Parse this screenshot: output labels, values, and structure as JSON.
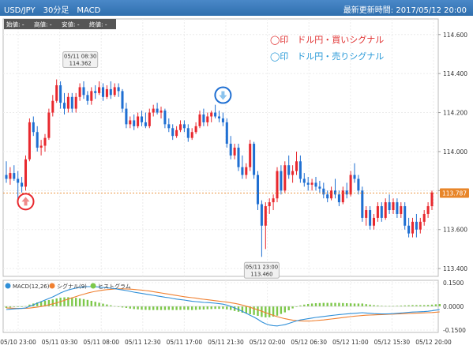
{
  "header": {
    "title": "USD/JPY　30分足　MACD",
    "updated": "最新更新時間: 2017/05/12 20:00"
  },
  "ohlc_box": {
    "labels": [
      "始値: -",
      "高値: -",
      "安値: -",
      "終値: -"
    ]
  },
  "legend": {
    "buy": "◯印　ドル円・買いシグナル",
    "sell": "◯印　ドル円・売りシグナル",
    "buy_color": "#e03030",
    "sell_color": "#2a9ad8"
  },
  "colors": {
    "up": "#e8282e",
    "down": "#1f6fd2",
    "macd": "#2f8fd8",
    "signal": "#f08030",
    "hist": "#7dc84a",
    "last_price_bg": "#e8862a"
  },
  "icons": {
    "buy_marker": "up-arrow-icon",
    "sell_marker": "down-arrow-icon"
  },
  "chart_data": [
    {
      "type": "candlestick",
      "title": "USD/JPY 30分足",
      "y_ticks": [
        "114.600",
        "114.400",
        "114.200",
        "114.000",
        "113.800",
        "113.600",
        "113.400"
      ],
      "ylim": [
        113.36,
        114.68
      ],
      "x_tick_labels": [
        "05/10 23:00",
        "05/11 03:30",
        "05/11 08:00",
        "05/11 12:30",
        "05/11 17:00",
        "05/11 21:30",
        "05/12 02:00",
        "05/12 06:30",
        "05/12 11:00",
        "05/12 15:30",
        "05/12 20:00"
      ],
      "last_price": "113.787",
      "high_annotation": {
        "time": "05/11 08:30",
        "value": "114.362"
      },
      "low_annotation": {
        "time": "05/11 23:00",
        "value": "113.460"
      },
      "signals": [
        {
          "type": "buy",
          "index": 5
        },
        {
          "type": "sell",
          "index": 56
        }
      ],
      "candles": [
        {
          "o": 113.88,
          "h": 113.95,
          "l": 113.84,
          "c": 113.86
        },
        {
          "o": 113.86,
          "h": 113.92,
          "l": 113.83,
          "c": 113.89
        },
        {
          "o": 113.89,
          "h": 113.93,
          "l": 113.85,
          "c": 113.86
        },
        {
          "o": 113.86,
          "h": 113.9,
          "l": 113.75,
          "c": 113.84
        },
        {
          "o": 113.84,
          "h": 113.87,
          "l": 113.79,
          "c": 113.82
        },
        {
          "o": 113.82,
          "h": 113.98,
          "l": 113.8,
          "c": 113.96
        },
        {
          "o": 113.96,
          "h": 114.17,
          "l": 113.95,
          "c": 114.15
        },
        {
          "o": 114.15,
          "h": 114.18,
          "l": 114.08,
          "c": 114.1
        },
        {
          "o": 114.1,
          "h": 114.13,
          "l": 114.0,
          "c": 114.02
        },
        {
          "o": 114.02,
          "h": 114.06,
          "l": 113.98,
          "c": 114.03
        },
        {
          "o": 114.03,
          "h": 114.09,
          "l": 114.0,
          "c": 114.07
        },
        {
          "o": 114.07,
          "h": 114.22,
          "l": 114.06,
          "c": 114.2
        },
        {
          "o": 114.2,
          "h": 114.29,
          "l": 114.18,
          "c": 114.26
        },
        {
          "o": 114.26,
          "h": 114.37,
          "l": 114.25,
          "c": 114.34
        },
        {
          "o": 114.34,
          "h": 114.36,
          "l": 114.22,
          "c": 114.25
        },
        {
          "o": 114.25,
          "h": 114.3,
          "l": 114.19,
          "c": 114.22
        },
        {
          "o": 114.22,
          "h": 114.3,
          "l": 114.2,
          "c": 114.28
        },
        {
          "o": 114.28,
          "h": 114.3,
          "l": 114.2,
          "c": 114.22
        },
        {
          "o": 114.22,
          "h": 114.3,
          "l": 114.2,
          "c": 114.28
        },
        {
          "o": 114.28,
          "h": 114.35,
          "l": 114.26,
          "c": 114.33
        },
        {
          "o": 114.33,
          "h": 114.36,
          "l": 114.27,
          "c": 114.29
        },
        {
          "o": 114.29,
          "h": 114.31,
          "l": 114.24,
          "c": 114.26
        },
        {
          "o": 114.26,
          "h": 114.33,
          "l": 114.24,
          "c": 114.31
        },
        {
          "o": 114.31,
          "h": 114.34,
          "l": 114.27,
          "c": 114.3
        },
        {
          "o": 114.3,
          "h": 114.36,
          "l": 114.29,
          "c": 114.33
        },
        {
          "o": 114.33,
          "h": 114.35,
          "l": 114.26,
          "c": 114.28
        },
        {
          "o": 114.28,
          "h": 114.34,
          "l": 114.27,
          "c": 114.32
        },
        {
          "o": 114.32,
          "h": 114.36,
          "l": 114.27,
          "c": 114.29
        },
        {
          "o": 114.29,
          "h": 114.35,
          "l": 114.28,
          "c": 114.33
        },
        {
          "o": 114.33,
          "h": 114.35,
          "l": 114.28,
          "c": 114.31
        },
        {
          "o": 114.31,
          "h": 114.32,
          "l": 114.2,
          "c": 114.22
        },
        {
          "o": 114.22,
          "h": 114.25,
          "l": 114.12,
          "c": 114.14
        },
        {
          "o": 114.14,
          "h": 114.18,
          "l": 114.12,
          "c": 114.16
        },
        {
          "o": 114.16,
          "h": 114.19,
          "l": 114.11,
          "c": 114.13
        },
        {
          "o": 114.13,
          "h": 114.2,
          "l": 114.12,
          "c": 114.18
        },
        {
          "o": 114.18,
          "h": 114.21,
          "l": 114.13,
          "c": 114.15
        },
        {
          "o": 114.15,
          "h": 114.2,
          "l": 114.12,
          "c": 114.13
        },
        {
          "o": 114.13,
          "h": 114.22,
          "l": 114.12,
          "c": 114.2
        },
        {
          "o": 114.2,
          "h": 114.24,
          "l": 114.18,
          "c": 114.22
        },
        {
          "o": 114.22,
          "h": 114.25,
          "l": 114.19,
          "c": 114.2
        },
        {
          "o": 114.2,
          "h": 114.23,
          "l": 114.17,
          "c": 114.21
        },
        {
          "o": 114.21,
          "h": 114.22,
          "l": 114.12,
          "c": 114.14
        },
        {
          "o": 114.14,
          "h": 114.17,
          "l": 114.1,
          "c": 114.12
        },
        {
          "o": 114.12,
          "h": 114.14,
          "l": 114.06,
          "c": 114.08
        },
        {
          "o": 114.08,
          "h": 114.13,
          "l": 114.07,
          "c": 114.11
        },
        {
          "o": 114.11,
          "h": 114.16,
          "l": 114.1,
          "c": 114.14
        },
        {
          "o": 114.14,
          "h": 114.16,
          "l": 114.1,
          "c": 114.12
        },
        {
          "o": 114.12,
          "h": 114.14,
          "l": 114.05,
          "c": 114.07
        },
        {
          "o": 114.07,
          "h": 114.12,
          "l": 114.06,
          "c": 114.1
        },
        {
          "o": 114.1,
          "h": 114.15,
          "l": 114.09,
          "c": 114.13
        },
        {
          "o": 114.13,
          "h": 114.21,
          "l": 114.12,
          "c": 114.19
        },
        {
          "o": 114.19,
          "h": 114.22,
          "l": 114.13,
          "c": 114.15
        },
        {
          "o": 114.15,
          "h": 114.2,
          "l": 114.13,
          "c": 114.18
        },
        {
          "o": 114.18,
          "h": 114.21,
          "l": 114.15,
          "c": 114.2
        },
        {
          "o": 114.2,
          "h": 114.24,
          "l": 114.17,
          "c": 114.18
        },
        {
          "o": 114.18,
          "h": 114.21,
          "l": 114.15,
          "c": 114.17
        },
        {
          "o": 114.17,
          "h": 114.2,
          "l": 114.13,
          "c": 114.15
        },
        {
          "o": 114.15,
          "h": 114.17,
          "l": 114.02,
          "c": 114.04
        },
        {
          "o": 114.04,
          "h": 114.08,
          "l": 113.96,
          "c": 113.98
        },
        {
          "o": 113.98,
          "h": 114.04,
          "l": 113.96,
          "c": 114.02
        },
        {
          "o": 114.02,
          "h": 114.04,
          "l": 113.9,
          "c": 113.92
        },
        {
          "o": 113.92,
          "h": 113.98,
          "l": 113.86,
          "c": 113.88
        },
        {
          "o": 113.88,
          "h": 113.94,
          "l": 113.86,
          "c": 113.92
        },
        {
          "o": 113.92,
          "h": 114.06,
          "l": 113.9,
          "c": 114.04
        },
        {
          "o": 114.04,
          "h": 114.05,
          "l": 113.86,
          "c": 113.88
        },
        {
          "o": 113.88,
          "h": 113.9,
          "l": 113.7,
          "c": 113.73
        },
        {
          "o": 113.73,
          "h": 113.75,
          "l": 113.46,
          "c": 113.62
        },
        {
          "o": 113.62,
          "h": 113.74,
          "l": 113.5,
          "c": 113.72
        },
        {
          "o": 113.72,
          "h": 113.76,
          "l": 113.68,
          "c": 113.74
        },
        {
          "o": 113.74,
          "h": 113.78,
          "l": 113.7,
          "c": 113.76
        },
        {
          "o": 113.76,
          "h": 113.92,
          "l": 113.74,
          "c": 113.9
        },
        {
          "o": 113.9,
          "h": 113.93,
          "l": 113.78,
          "c": 113.8
        },
        {
          "o": 113.8,
          "h": 113.95,
          "l": 113.79,
          "c": 113.93
        },
        {
          "o": 113.93,
          "h": 113.98,
          "l": 113.86,
          "c": 113.88
        },
        {
          "o": 113.88,
          "h": 113.93,
          "l": 113.84,
          "c": 113.9
        },
        {
          "o": 113.9,
          "h": 114.0,
          "l": 113.88,
          "c": 113.95
        },
        {
          "o": 113.95,
          "h": 113.98,
          "l": 113.84,
          "c": 113.86
        },
        {
          "o": 113.86,
          "h": 113.89,
          "l": 113.82,
          "c": 113.84
        },
        {
          "o": 113.84,
          "h": 113.87,
          "l": 113.8,
          "c": 113.83
        },
        {
          "o": 113.83,
          "h": 113.86,
          "l": 113.8,
          "c": 113.84
        },
        {
          "o": 113.84,
          "h": 113.87,
          "l": 113.8,
          "c": 113.82
        },
        {
          "o": 113.82,
          "h": 113.85,
          "l": 113.79,
          "c": 113.81
        },
        {
          "o": 113.81,
          "h": 113.84,
          "l": 113.76,
          "c": 113.78
        },
        {
          "o": 113.78,
          "h": 113.8,
          "l": 113.74,
          "c": 113.76
        },
        {
          "o": 113.76,
          "h": 113.82,
          "l": 113.75,
          "c": 113.8
        },
        {
          "o": 113.8,
          "h": 113.86,
          "l": 113.76,
          "c": 113.78
        },
        {
          "o": 113.78,
          "h": 113.8,
          "l": 113.72,
          "c": 113.74
        },
        {
          "o": 113.74,
          "h": 113.82,
          "l": 113.73,
          "c": 113.8
        },
        {
          "o": 113.8,
          "h": 113.84,
          "l": 113.76,
          "c": 113.78
        },
        {
          "o": 113.78,
          "h": 113.9,
          "l": 113.77,
          "c": 113.88
        },
        {
          "o": 113.88,
          "h": 113.94,
          "l": 113.84,
          "c": 113.86
        },
        {
          "o": 113.86,
          "h": 113.88,
          "l": 113.78,
          "c": 113.8
        },
        {
          "o": 113.8,
          "h": 113.82,
          "l": 113.64,
          "c": 113.66
        },
        {
          "o": 113.66,
          "h": 113.72,
          "l": 113.62,
          "c": 113.7
        },
        {
          "o": 113.7,
          "h": 113.72,
          "l": 113.6,
          "c": 113.62
        },
        {
          "o": 113.62,
          "h": 113.68,
          "l": 113.6,
          "c": 113.66
        },
        {
          "o": 113.66,
          "h": 113.74,
          "l": 113.64,
          "c": 113.72
        },
        {
          "o": 113.72,
          "h": 113.74,
          "l": 113.64,
          "c": 113.66
        },
        {
          "o": 113.66,
          "h": 113.76,
          "l": 113.65,
          "c": 113.74
        },
        {
          "o": 113.74,
          "h": 113.78,
          "l": 113.68,
          "c": 113.7
        },
        {
          "o": 113.7,
          "h": 113.76,
          "l": 113.68,
          "c": 113.74
        },
        {
          "o": 113.74,
          "h": 113.76,
          "l": 113.66,
          "c": 113.68
        },
        {
          "o": 113.68,
          "h": 113.74,
          "l": 113.66,
          "c": 113.72
        },
        {
          "o": 113.72,
          "h": 113.74,
          "l": 113.6,
          "c": 113.62
        },
        {
          "o": 113.62,
          "h": 113.66,
          "l": 113.56,
          "c": 113.58
        },
        {
          "o": 113.58,
          "h": 113.66,
          "l": 113.56,
          "c": 113.64
        },
        {
          "o": 113.64,
          "h": 113.68,
          "l": 113.56,
          "c": 113.6
        },
        {
          "o": 113.6,
          "h": 113.66,
          "l": 113.58,
          "c": 113.64
        },
        {
          "o": 113.64,
          "h": 113.7,
          "l": 113.62,
          "c": 113.68
        },
        {
          "o": 113.68,
          "h": 113.74,
          "l": 113.66,
          "c": 113.72
        },
        {
          "o": 113.72,
          "h": 113.8,
          "l": 113.7,
          "c": 113.79
        }
      ]
    },
    {
      "type": "line",
      "title": "MACD",
      "legend": [
        "MACD(12,26)",
        "シグナル(9)",
        "ヒストグラム"
      ],
      "y_ticks": [
        "0.1500",
        "0.0000",
        "-0.1500"
      ],
      "ylim": [
        -0.165,
        0.165
      ],
      "series": [
        {
          "name": "MACD(12,26)",
          "values": [
            -0.02,
            -0.018,
            -0.016,
            -0.014,
            -0.013,
            -0.01,
            0.0,
            0.01,
            0.02,
            0.03,
            0.04,
            0.05,
            0.06,
            0.072,
            0.085,
            0.095,
            0.104,
            0.11,
            0.116,
            0.12,
            0.123,
            0.125,
            0.125,
            0.124,
            0.122,
            0.12,
            0.118,
            0.115,
            0.112,
            0.108,
            0.104,
            0.1,
            0.095,
            0.09,
            0.086,
            0.082,
            0.078,
            0.074,
            0.07,
            0.066,
            0.062,
            0.058,
            0.055,
            0.05,
            0.046,
            0.043,
            0.04,
            0.036,
            0.032,
            0.03,
            0.028,
            0.025,
            0.024,
            0.022,
            0.02,
            0.017,
            0.014,
            0.008,
            0.0,
            -0.01,
            -0.02,
            -0.032,
            -0.044,
            -0.056,
            -0.068,
            -0.082,
            -0.098,
            -0.11,
            -0.118,
            -0.122,
            -0.124,
            -0.12,
            -0.116,
            -0.108,
            -0.1,
            -0.092,
            -0.086,
            -0.082,
            -0.078,
            -0.074,
            -0.07,
            -0.067,
            -0.064,
            -0.061,
            -0.058,
            -0.055,
            -0.052,
            -0.05,
            -0.048,
            -0.046,
            -0.044,
            -0.042,
            -0.04,
            -0.042,
            -0.044,
            -0.046,
            -0.047,
            -0.048,
            -0.048,
            -0.047,
            -0.046,
            -0.044,
            -0.042,
            -0.04,
            -0.038,
            -0.036,
            -0.035,
            -0.034,
            -0.033,
            -0.031,
            -0.028,
            -0.024,
            -0.02
          ]
        },
        {
          "name": "シグナル(9)",
          "values": [
            -0.01,
            -0.011,
            -0.012,
            -0.013,
            -0.013,
            -0.012,
            -0.011,
            -0.008,
            -0.005,
            -0.001,
            0.004,
            0.01,
            0.016,
            0.022,
            0.03,
            0.038,
            0.046,
            0.054,
            0.062,
            0.07,
            0.077,
            0.084,
            0.09,
            0.095,
            0.099,
            0.103,
            0.106,
            0.108,
            0.11,
            0.111,
            0.111,
            0.11,
            0.109,
            0.107,
            0.105,
            0.103,
            0.1,
            0.097,
            0.093,
            0.089,
            0.085,
            0.081,
            0.077,
            0.073,
            0.069,
            0.065,
            0.061,
            0.058,
            0.055,
            0.052,
            0.048,
            0.045,
            0.042,
            0.039,
            0.036,
            0.033,
            0.03,
            0.027,
            0.023,
            0.019,
            0.014,
            0.008,
            0.001,
            -0.006,
            -0.014,
            -0.022,
            -0.031,
            -0.04,
            -0.049,
            -0.057,
            -0.065,
            -0.072,
            -0.078,
            -0.083,
            -0.087,
            -0.09,
            -0.092,
            -0.093,
            -0.093,
            -0.092,
            -0.09,
            -0.088,
            -0.086,
            -0.083,
            -0.08,
            -0.077,
            -0.074,
            -0.071,
            -0.068,
            -0.065,
            -0.062,
            -0.06,
            -0.058,
            -0.056,
            -0.055,
            -0.054,
            -0.053,
            -0.052,
            -0.051,
            -0.05,
            -0.049,
            -0.048,
            -0.047,
            -0.046,
            -0.045,
            -0.044,
            -0.043,
            -0.042,
            -0.041,
            -0.04,
            -0.039,
            -0.037,
            -0.035
          ]
        }
      ]
    }
  ]
}
